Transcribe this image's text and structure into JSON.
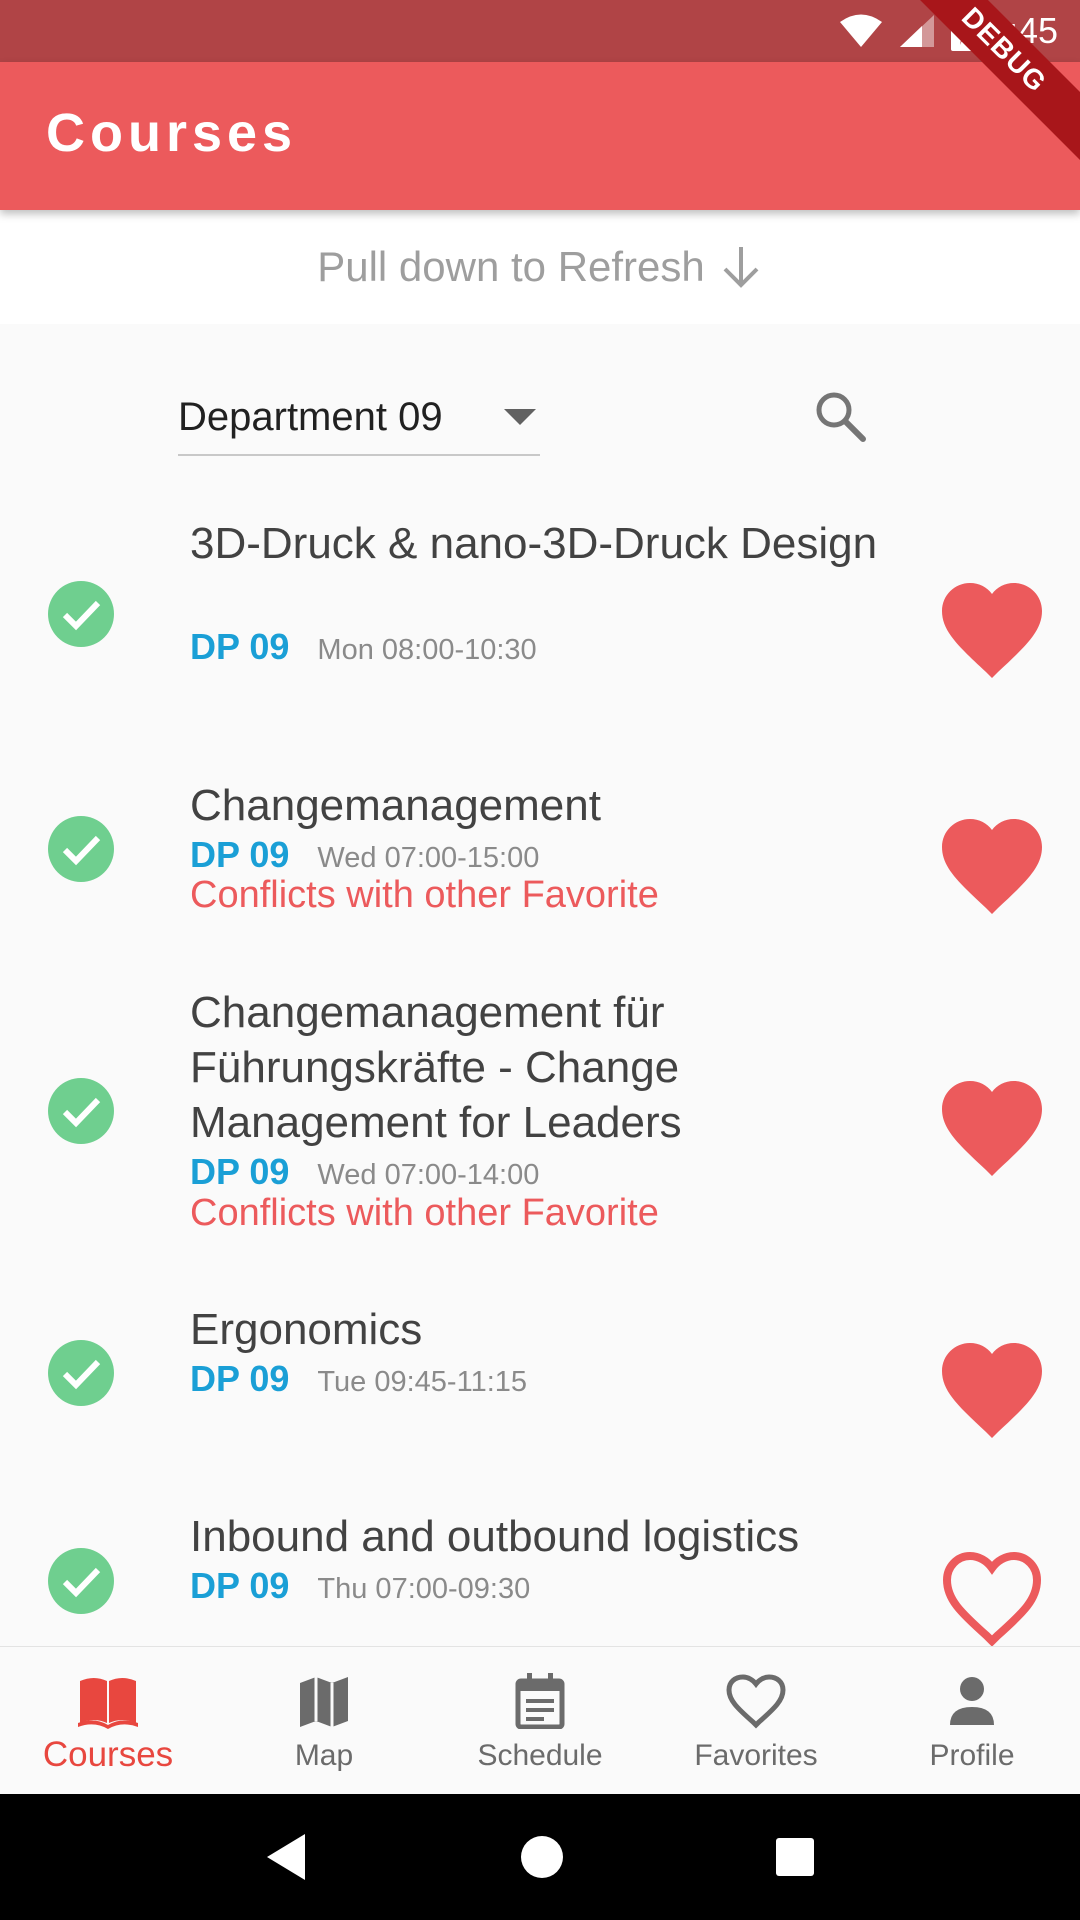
{
  "status_bar": {
    "time": "9:45",
    "debug_label": "DEBUG"
  },
  "app_bar": {
    "title": "Courses"
  },
  "refresh": {
    "label": "Pull down to Refresh"
  },
  "filter": {
    "department": "Department 09"
  },
  "courses": [
    {
      "title": "3D-Druck & nano-3D-Druck Design",
      "code": "DP 09",
      "time": "Mon 08:00-10:30",
      "conflict": "",
      "favorite": true
    },
    {
      "title": "Changemanagement",
      "code": "DP 09",
      "time": "Wed 07:00-15:00",
      "conflict": "Conflicts with other Favorite",
      "favorite": true
    },
    {
      "title": "Changemanagement für Führungskräfte - Change Management for Leaders",
      "code": "DP 09",
      "time": "Wed 07:00-14:00",
      "conflict": "Conflicts with other Favorite",
      "favorite": true
    },
    {
      "title": "Ergonomics",
      "code": "DP 09",
      "time": "Tue 09:45-11:15",
      "conflict": "",
      "favorite": true
    },
    {
      "title": "Inbound and outbound logistics",
      "code": "DP 09",
      "time": "Thu 07:00-09:30",
      "conflict": "",
      "favorite": false
    }
  ],
  "bottom_nav": {
    "items": [
      {
        "label": "Courses",
        "icon": "book-icon",
        "active": true
      },
      {
        "label": "Map",
        "icon": "map-icon",
        "active": false
      },
      {
        "label": "Schedule",
        "icon": "calendar-icon",
        "active": false
      },
      {
        "label": "Favorites",
        "icon": "heart-outline-icon",
        "active": false
      },
      {
        "label": "Profile",
        "icon": "person-icon",
        "active": false
      }
    ]
  },
  "colors": {
    "primary": "#ec5a5c",
    "status_bar": "#b04446",
    "accent_blue": "#1a9fd6",
    "check_green": "#6fcf8f"
  }
}
